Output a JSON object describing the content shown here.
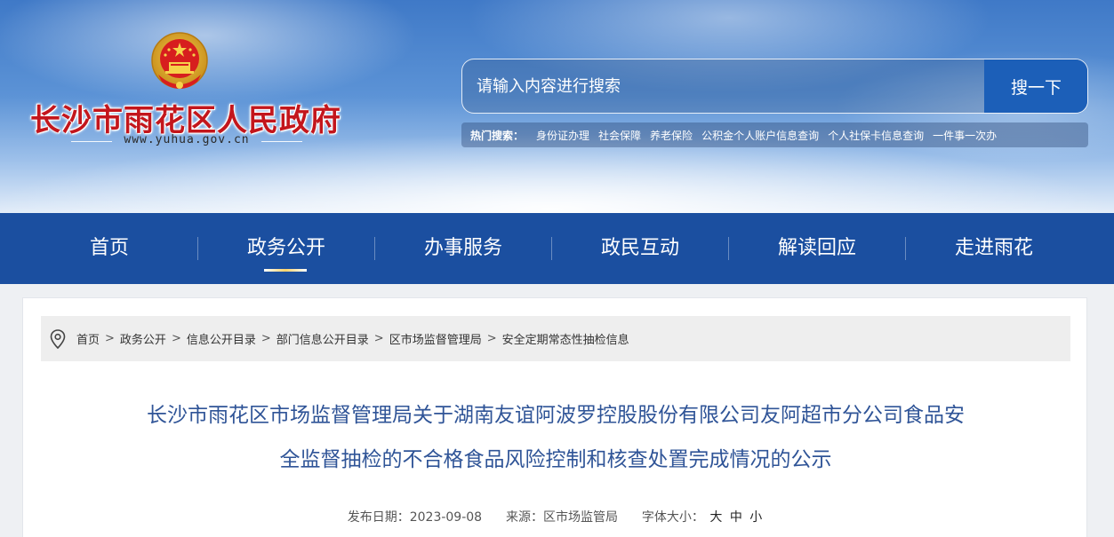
{
  "site": {
    "title": "长沙市雨花区人民政府",
    "url": "www.yuhua.gov.cn"
  },
  "search": {
    "placeholder": "请输入内容进行搜索",
    "button_label": "搜一下"
  },
  "hot_search": {
    "label": "热门搜索：",
    "links": [
      "身份证办理",
      "社会保障",
      "养老保险",
      "公积金个人账户信息查询",
      "个人社保卡信息查询",
      "一件事一次办"
    ]
  },
  "nav": {
    "items": [
      "首页",
      "政务公开",
      "办事服务",
      "政民互动",
      "解读回应",
      "走进雨花"
    ],
    "active": "政务公开"
  },
  "breadcrumb": [
    "首页",
    "政务公开",
    "信息公开目录",
    "部门信息公开目录",
    "区市场监督管理局",
    "安全定期常态性抽检信息"
  ],
  "breadcrumb_separator": ">",
  "article": {
    "title_line1": "长沙市雨花区市场监督管理局关于湖南友谊阿波罗控股股份有限公司友阿超市分公司食品安",
    "title_line2": "全监督抽检的不合格食品风险控制和核查处置完成情况的公示",
    "publish_label": "发布日期：",
    "publish_date": "2023-09-08",
    "source_label": "来源：",
    "source": "区市场监管局",
    "font_size_label": "字体大小：",
    "font_sizes": [
      "大",
      "中",
      "小"
    ]
  },
  "colors": {
    "nav_bg": "#1b4fa0",
    "title_red": "#c3161c",
    "article_title": "#2f5497",
    "search_button": "#1c5fb8"
  }
}
